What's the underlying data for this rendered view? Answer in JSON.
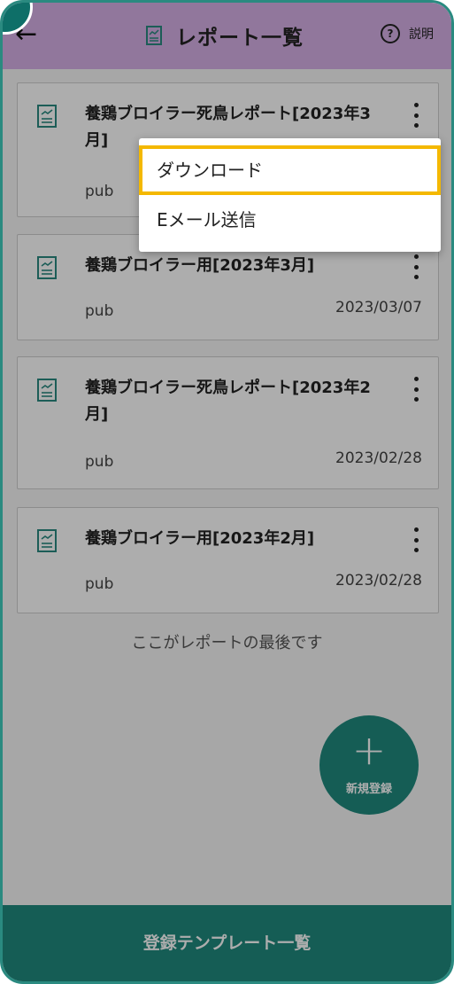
{
  "header": {
    "title": "レポート一覧",
    "help_label": "説明",
    "help_icon_glyph": "?",
    "back_glyph": "←"
  },
  "reports": [
    {
      "name": "養鶏ブロイラー死鳥レポート[2023年3月]",
      "owner": "pub",
      "date": ""
    },
    {
      "name": "養鶏ブロイラー用[2023年3月]",
      "owner": "pub",
      "date": "2023/03/07"
    },
    {
      "name": "養鶏ブロイラー死鳥レポート[2023年2月]",
      "owner": "pub",
      "date": "2023/02/28"
    },
    {
      "name": "養鶏ブロイラー用[2023年2月]",
      "owner": "pub",
      "date": "2023/02/28"
    }
  ],
  "end_note": "ここがレポートの最後です",
  "fab": {
    "plus": "+",
    "label": "新規登録"
  },
  "footer": {
    "label": "登録テンプレート一覧"
  },
  "context_menu": {
    "items": [
      {
        "label": "ダウンロード",
        "highlighted": true
      },
      {
        "label": "Eメール送信",
        "highlighted": false
      }
    ]
  },
  "colors": {
    "header_bg": "#d6b0e6",
    "accent": "#1f8a7e",
    "highlight_border": "#f4b800"
  }
}
